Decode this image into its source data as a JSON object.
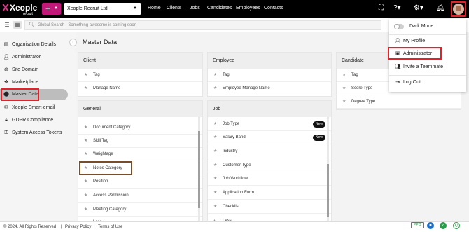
{
  "brand": {
    "logo_text": "Xeople",
    "logo_sub": "recruit",
    "plus": "+"
  },
  "company_select": {
    "value": "Xeople Recruit Ltd"
  },
  "nav": [
    {
      "label": "Home"
    },
    {
      "label": "Clients"
    },
    {
      "label": "Jobs"
    },
    {
      "label": "Candidates"
    },
    {
      "label": "Employees"
    },
    {
      "label": "Contacts"
    }
  ],
  "search": {
    "placeholder": "Global Search - Something awesome is coming soon"
  },
  "sidebar": {
    "items": [
      {
        "label": "Organisation Details",
        "icon": "document-icon"
      },
      {
        "label": "Administrator",
        "icon": "person-icon"
      },
      {
        "label": "Site Domain",
        "icon": "globe-icon"
      },
      {
        "label": "Marketplace",
        "icon": "move-icon"
      },
      {
        "label": "Master Data",
        "icon": "database-icon",
        "active": true
      },
      {
        "label": "Xeople Smart-email",
        "icon": "mail-icon"
      },
      {
        "label": "GDPR Compliance",
        "icon": "lock-icon"
      },
      {
        "label": "System Access Tokens",
        "icon": "key-icon"
      }
    ]
  },
  "main": {
    "title": "Master Data",
    "panels": {
      "client": {
        "title": "Client",
        "items": [
          "Tag",
          "Manage Name"
        ]
      },
      "employee": {
        "title": "Employee",
        "items": [
          "Tag",
          "Employee Manage Name"
        ]
      },
      "candidate": {
        "title": "Candidate",
        "items": [
          "Tag",
          "Score Type",
          "Degree Type"
        ]
      },
      "general": {
        "title": "General",
        "items": [
          "Document Category",
          "Skill Tag",
          "Weightage",
          "Notes Category",
          "Position",
          "Access Permission",
          "Meeting Category"
        ],
        "more": "Less"
      },
      "job": {
        "title": "Job",
        "items": [
          "Job Type",
          "Salary Band",
          "Industry",
          "Customer Type",
          "Job Workflow",
          "Application Form",
          "Checklist"
        ],
        "badges": [
          "New",
          "New"
        ],
        "more": "Less"
      }
    }
  },
  "dropdown": {
    "items": [
      {
        "label": "Dark Mode",
        "icon": "toggle-icon"
      },
      {
        "label": "My Profile",
        "icon": "person-icon"
      },
      {
        "label": "Administrator",
        "icon": "admin-icon"
      },
      {
        "label": "Invite a Teammate",
        "icon": "add-user-icon"
      },
      {
        "label": "Log Out",
        "icon": "logout-icon"
      }
    ]
  },
  "footer": {
    "copyright": "© 2024. All Rights Reserved",
    "sep": "|",
    "privacy": "Privacy Policy",
    "terms": "Terms of Use",
    "badge": "PPO"
  },
  "colors": {
    "accent": "#c2187a",
    "highlight": "#e3212b",
    "notes_highlight": "#7a4d2a"
  }
}
